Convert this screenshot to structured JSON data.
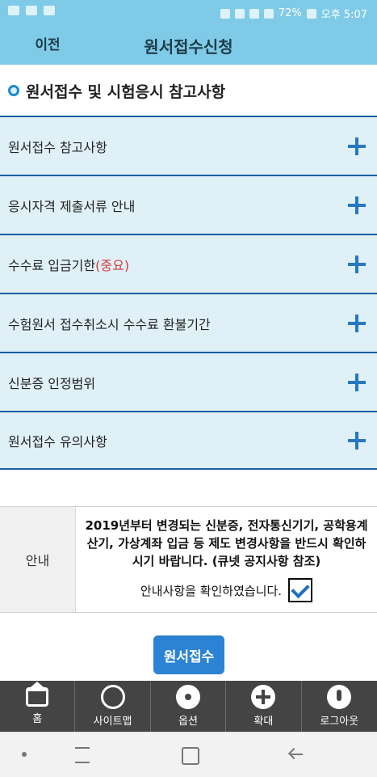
{
  "status_bar": {
    "battery_percent": "72%",
    "time": "오후 5:07"
  },
  "header": {
    "back_label": "이전",
    "title": "원서접수신청"
  },
  "section": {
    "title": "원서접수 및 시험응시 참고사항"
  },
  "accordion": {
    "items": [
      {
        "label": "원서접수 참고사항"
      },
      {
        "label": "응시자격 제출서류 안내"
      },
      {
        "label": "수수료 입금기한",
        "emphasis": "(중요)"
      },
      {
        "label": "수험원서 접수취소시 수수료 환불기간"
      },
      {
        "label": "신분증 인정범위"
      },
      {
        "label": "원서접수 유의사항"
      }
    ]
  },
  "notice": {
    "label": "안내",
    "text": "2019년부터 변경되는 신분증, 전자통신기기, 공학용계산기, 가상계좌 입금 등 제도 변경사항을 반드시 확인하시기 바랍니다. (큐넷 공지사항 참조)",
    "confirm_label": "안내사항을 확인하였습니다.",
    "checked": true
  },
  "submit_button": {
    "label": "원서접수"
  },
  "bottom_nav": {
    "items": [
      {
        "label": "홈",
        "icon": "home-icon"
      },
      {
        "label": "사이트맵",
        "icon": "globe-icon"
      },
      {
        "label": "옵션",
        "icon": "gear-icon"
      },
      {
        "label": "확대",
        "icon": "plus-icon"
      },
      {
        "label": "로그아웃",
        "icon": "power-icon"
      }
    ]
  }
}
